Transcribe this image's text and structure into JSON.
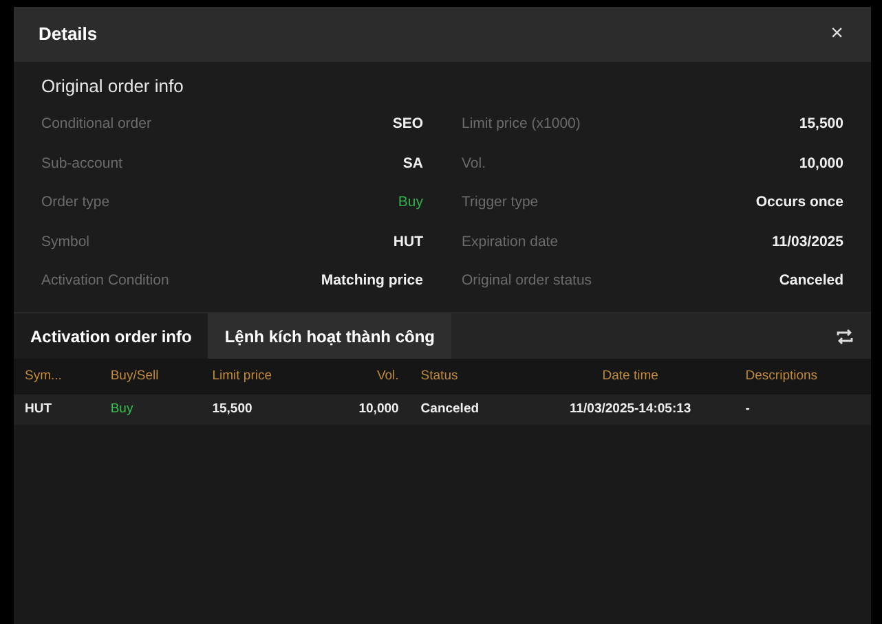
{
  "dialog": {
    "title": "Details",
    "close": "×"
  },
  "original_info": {
    "heading": "Original order info",
    "left": [
      {
        "label": "Conditional order",
        "value": "SEO",
        "positive": false
      },
      {
        "label": "Sub-account",
        "value": "SA",
        "positive": false
      },
      {
        "label": "Order type",
        "value": "Buy",
        "positive": true
      },
      {
        "label": "Symbol",
        "value": "HUT",
        "positive": false
      },
      {
        "label": "Activation Condition",
        "value": "Matching price",
        "positive": false
      }
    ],
    "right": [
      {
        "label": "Limit price (x1000)",
        "value": "15,500",
        "positive": false
      },
      {
        "label": "Vol.",
        "value": "10,000",
        "positive": false
      },
      {
        "label": "Trigger type",
        "value": "Occurs once",
        "positive": false
      },
      {
        "label": "Expiration date",
        "value": "11/03/2025",
        "positive": false
      },
      {
        "label": "Original order status",
        "value": "Canceled",
        "positive": false
      }
    ]
  },
  "tabs": [
    {
      "label": "Activation order info",
      "selected": false
    },
    {
      "label": "Lệnh kích hoạt thành công",
      "selected": true
    }
  ],
  "table": {
    "columns": [
      "Sym...",
      "Buy/Sell",
      "Limit price",
      "Vol.",
      "Status",
      "Date time",
      "Descriptions"
    ],
    "rows": [
      {
        "cells": [
          "HUT",
          "Buy",
          "15,500",
          "10,000",
          "Canceled",
          "11/03/2025-14:05:13",
          "-"
        ],
        "side_positive": true
      }
    ]
  }
}
